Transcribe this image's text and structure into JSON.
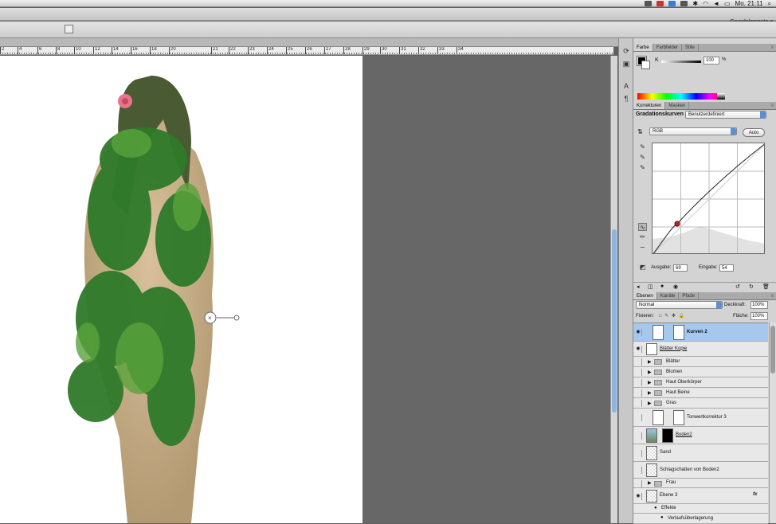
{
  "menubar": {
    "clock": "Mo. 21:11",
    "search_icon": "magnifier"
  },
  "appbar": {
    "workspace": "Grundelemente"
  },
  "ruler": {
    "ticks": [
      "2",
      "4",
      "6",
      "8",
      "10",
      "12",
      "14",
      "16",
      "18",
      "20",
      "22",
      "24",
      "26",
      "28",
      "30",
      "32",
      "34"
    ],
    "extra": [
      "21",
      "23",
      "25",
      "27",
      "29",
      "31",
      "33"
    ]
  },
  "color_panel": {
    "tabs": [
      "Farbe",
      "Farbfelder",
      "Stile"
    ],
    "k_label": "K",
    "k_value": "100",
    "k_unit": "%"
  },
  "adjustments_panel": {
    "tabs": [
      "Korrekturen",
      "Masken"
    ],
    "title": "Gradationskurven",
    "preset": "Benutzerdefiniert",
    "channel": "RGB",
    "auto_label": "Auto",
    "ausgabe_label": "Ausgabe:",
    "ausgabe_value": "69",
    "eingabe_label": "Eingabe:",
    "eingabe_value": "54"
  },
  "layers_panel": {
    "tabs": [
      "Ebenen",
      "Kanäle",
      "Pfade"
    ],
    "blend_mode": "Normal",
    "deckkraft_label": "Deckkraft:",
    "deckkraft_value": "100%",
    "fixieren_label": "Fixieren:",
    "flaeche_label": "Fläche:",
    "flaeche_value": "100%",
    "layers": [
      {
        "name": "Kurven 2",
        "type": "adjustment",
        "selected": true,
        "visible": true
      },
      {
        "name": "Blätter Kopie",
        "type": "smart",
        "visible": true
      },
      {
        "name": "Blätter",
        "type": "group"
      },
      {
        "name": "Blumen",
        "type": "group"
      },
      {
        "name": "Haut Oberkörper",
        "type": "group"
      },
      {
        "name": "Haut Beine",
        "type": "group"
      },
      {
        "name": "Gras",
        "type": "group"
      },
      {
        "name": "Tonwertkorrektur 3",
        "type": "adjustment"
      },
      {
        "name": "Boden2",
        "type": "image"
      },
      {
        "name": "Sand",
        "type": "pixel"
      },
      {
        "name": "Schlagschatten von Boden2",
        "type": "pixel"
      },
      {
        "name": "Frau",
        "type": "group"
      },
      {
        "name": "Ebene 3",
        "type": "pixel",
        "visible": true,
        "fx": "fx"
      },
      {
        "name": "Effekte",
        "type": "effects-header"
      },
      {
        "name": "Verlaufsüberlagerung",
        "type": "effect"
      }
    ]
  },
  "colors": {
    "selection": "#a6c8ef",
    "pasteboard": "#676767",
    "scroll_accent": "#8fb4e0",
    "curve_point": "#cc2222"
  }
}
